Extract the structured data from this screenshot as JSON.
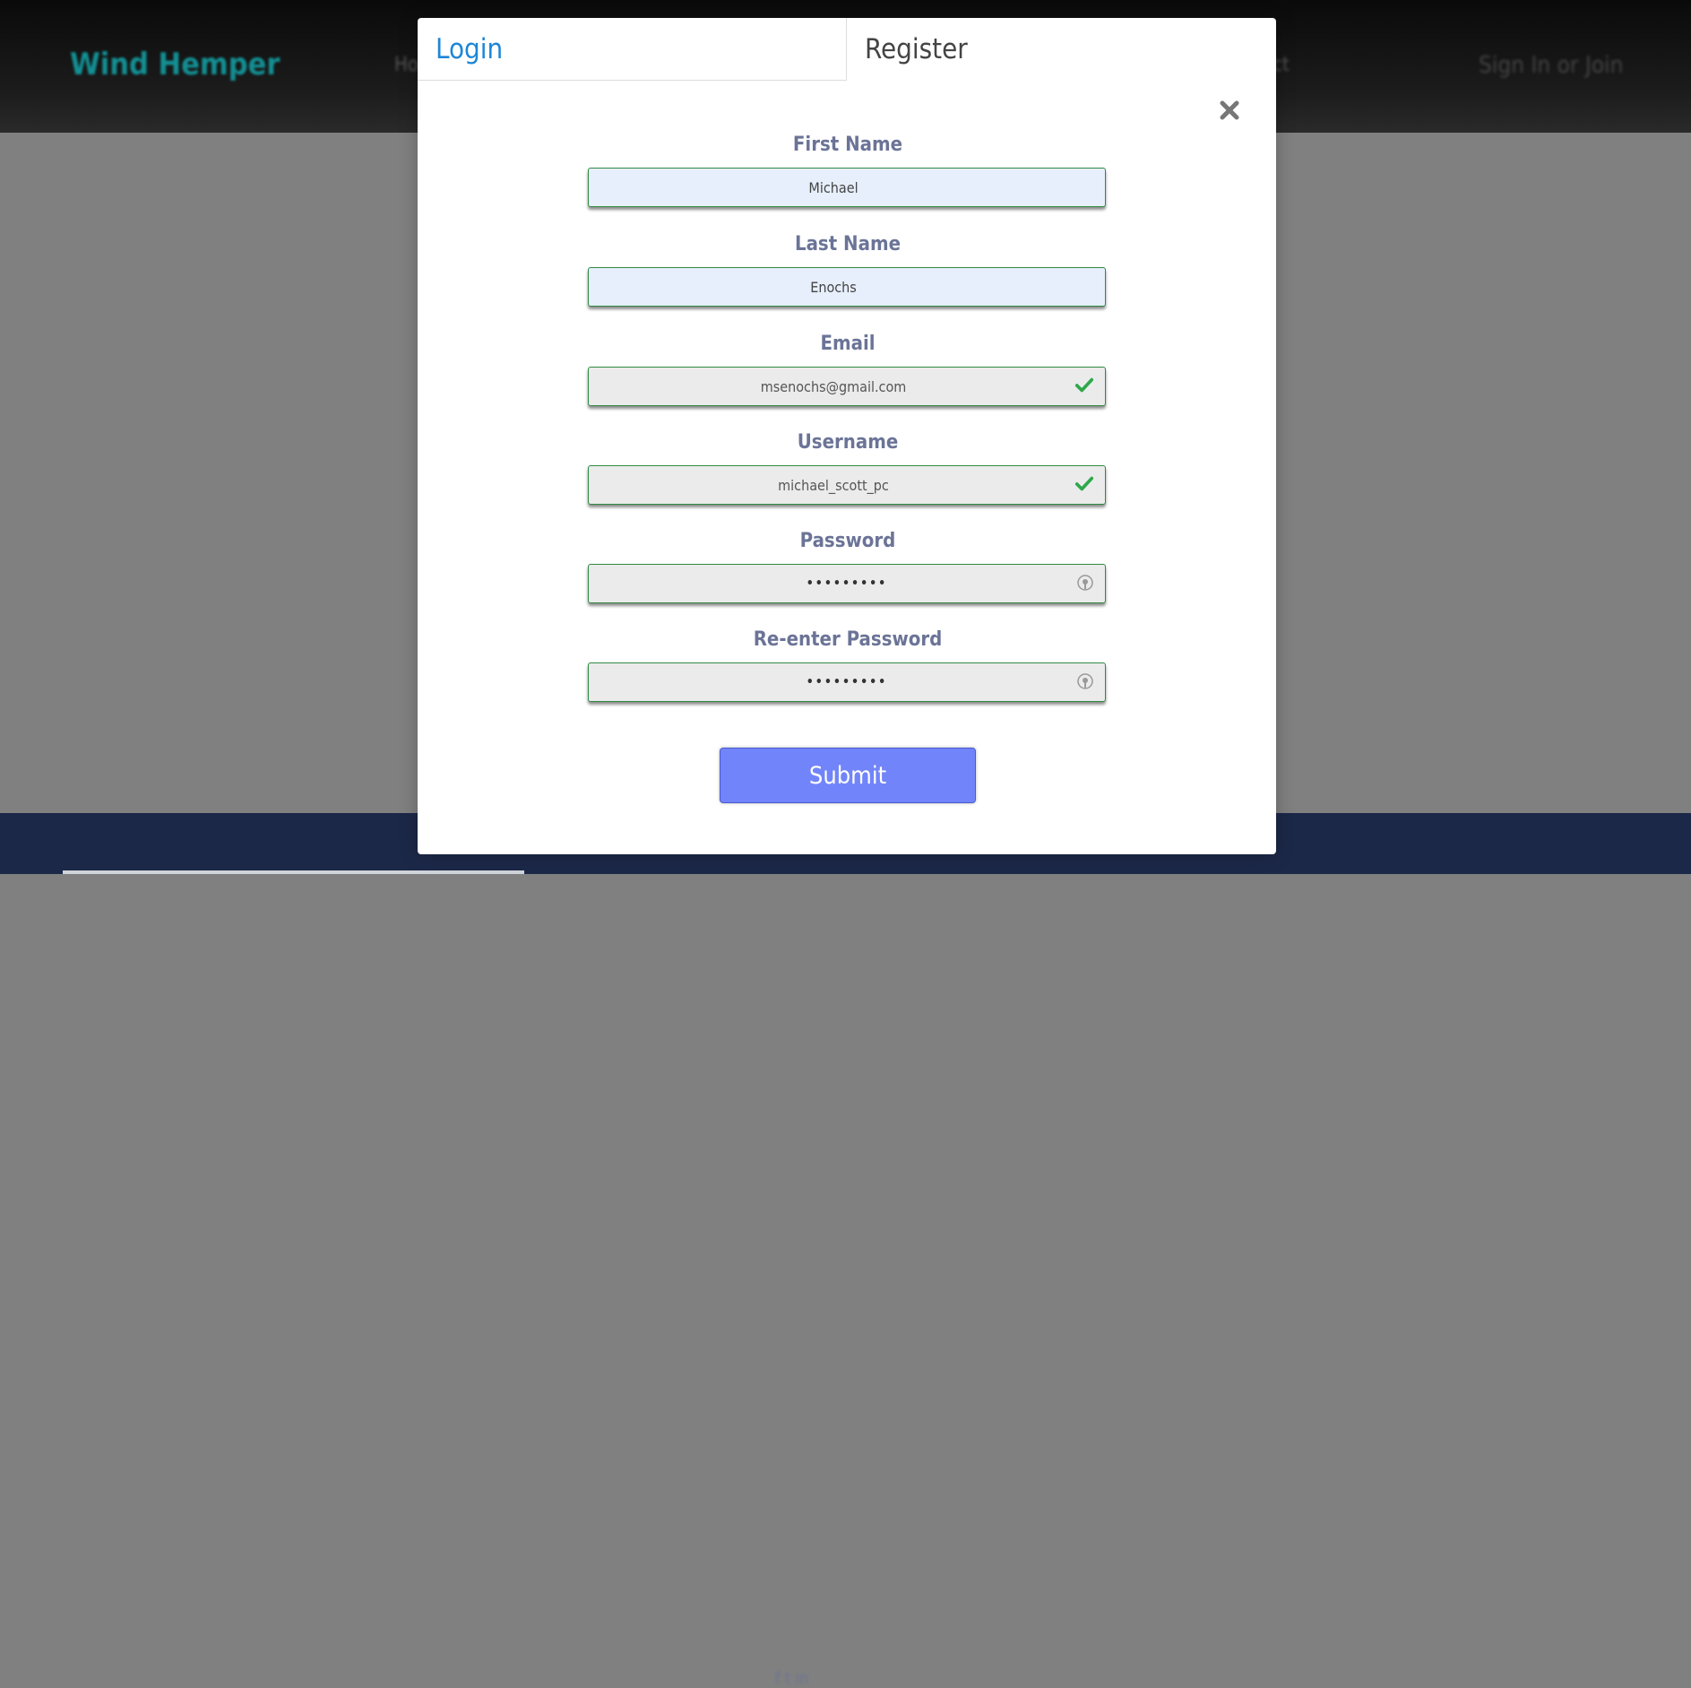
{
  "background": {
    "brand": "Wind Hemper",
    "nav_left": "Ho",
    "nav_right": "ct",
    "signin": "Sign In or Join",
    "footer_text": "f  t  in"
  },
  "modal": {
    "tabs": [
      {
        "label": "Login",
        "active": false
      },
      {
        "label": "Register",
        "active": true
      }
    ],
    "close_icon": "close-icon",
    "fields": {
      "first_name": {
        "label": "First Name",
        "value": "Michael"
      },
      "last_name": {
        "label": "Last Name",
        "value": "Enochs"
      },
      "email": {
        "label": "Email",
        "value": "msenochs@gmail.com",
        "valid": true
      },
      "username": {
        "label": "Username",
        "value": "michael_scott_pc",
        "valid": true
      },
      "password": {
        "label": "Password",
        "value": "•••••••••"
      },
      "reenter_password": {
        "label": "Re-enter Password",
        "value": "•••••••••"
      }
    },
    "submit_label": "Submit"
  },
  "colors": {
    "accent": "#1e86d6",
    "submit": "#7184fa",
    "valid": "#2e8a43",
    "label": "#6b7497"
  }
}
